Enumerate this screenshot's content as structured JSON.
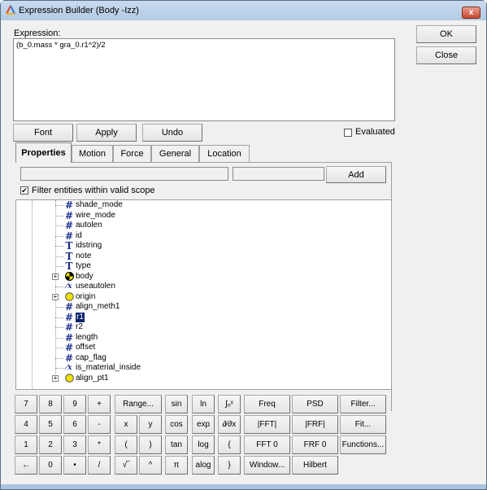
{
  "window": {
    "title": "Expression Builder (Body -Izz)",
    "close_glyph": "x"
  },
  "expression": {
    "label": "Expression:",
    "value": "(b_0.mass * gra_0.r1^2)/2"
  },
  "buttons": {
    "ok": "OK",
    "close": "Close",
    "font": "Font",
    "apply": "Apply",
    "undo": "Undo",
    "add": "Add"
  },
  "evaluated": {
    "label": "Evaluated",
    "checked": false
  },
  "tabs": [
    {
      "label": "Properties",
      "active": true
    },
    {
      "label": "Motion"
    },
    {
      "label": "Force"
    },
    {
      "label": "General"
    },
    {
      "label": "Location"
    }
  ],
  "filter": {
    "label": "Filter entities within valid scope",
    "checked": true,
    "check_glyph": "✔"
  },
  "tree": [
    {
      "icon": "hash-icon",
      "glyph": "#",
      "label": "shade_mode"
    },
    {
      "icon": "hash-icon",
      "glyph": "#",
      "label": "wire_mode"
    },
    {
      "icon": "hash-icon",
      "glyph": "#",
      "label": "autolen"
    },
    {
      "icon": "hash-icon",
      "glyph": "#",
      "label": "id"
    },
    {
      "icon": "text-icon",
      "glyph": "T",
      "label": "idstring"
    },
    {
      "icon": "text-icon",
      "glyph": "T",
      "label": "note"
    },
    {
      "icon": "text-icon",
      "glyph": "T",
      "label": "type"
    },
    {
      "icon": "body-icon",
      "glyph": "",
      "label": "body",
      "expandable": true
    },
    {
      "icon": "boolean-icon",
      "glyph": "⁄x",
      "label": "useautolen"
    },
    {
      "icon": "point-icon",
      "glyph": "",
      "label": "origin",
      "expandable": true
    },
    {
      "icon": "hash-icon",
      "glyph": "#",
      "label": "align_meth1"
    },
    {
      "icon": "hash-icon",
      "glyph": "#",
      "label": "r1",
      "selected": true
    },
    {
      "icon": "hash-icon",
      "glyph": "#",
      "label": "r2"
    },
    {
      "icon": "hash-icon",
      "glyph": "#",
      "label": "length"
    },
    {
      "icon": "hash-icon",
      "glyph": "#",
      "label": "offset"
    },
    {
      "icon": "hash-icon",
      "glyph": "#",
      "label": "cap_flag"
    },
    {
      "icon": "boolean-icon",
      "glyph": "⁄x",
      "label": "is_material_inside"
    },
    {
      "icon": "point-icon",
      "glyph": "",
      "label": "align_pt1",
      "expandable": true
    }
  ],
  "keypad": [
    [
      "7",
      "8",
      "9",
      "+",
      "Range...",
      "sin",
      "ln",
      "∫ₒˣ",
      "Freq",
      "PSD",
      "Filter..."
    ],
    [
      "4",
      "5",
      "6",
      "-",
      "x",
      "y",
      "cos",
      "exp",
      "∂⁄∂x",
      "|FFT|",
      "|FRF|",
      "Fit..."
    ],
    [
      "1",
      "2",
      "3",
      "*",
      "(",
      ")",
      "tan",
      "log",
      "{",
      "FFT 0",
      "FRF 0",
      "Functions..."
    ],
    [
      "←",
      "0",
      "•",
      "/",
      "√‾",
      "^",
      "π",
      "alog",
      "}",
      "Window...",
      "Hilbert"
    ]
  ],
  "colors": {
    "selection": "#0a246a",
    "icon": "#1c2d8c",
    "point": "#f0e000"
  }
}
